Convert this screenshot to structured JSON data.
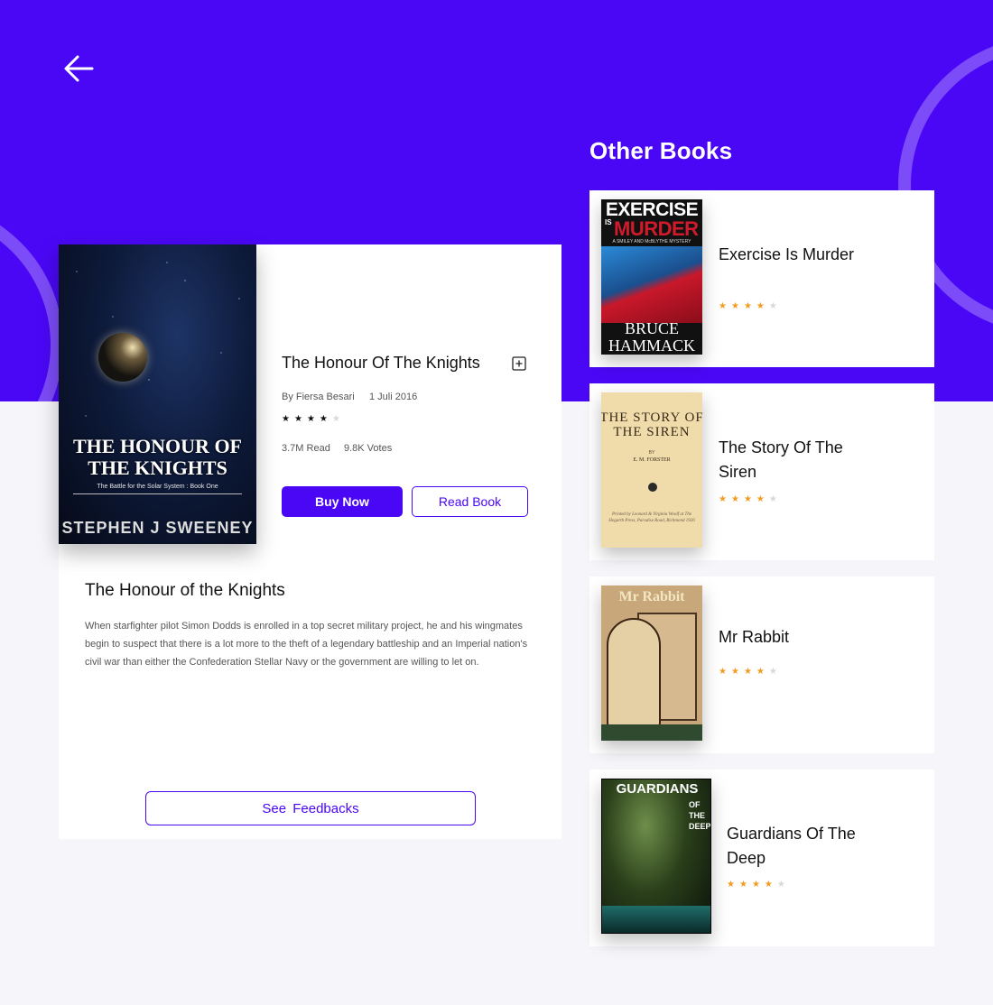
{
  "colors": {
    "accent": "#4a07f5",
    "star": "#f29c1f",
    "background": "#f6f6fa"
  },
  "header": {
    "back_icon": "arrow-left-icon"
  },
  "book": {
    "cover_title": "THE HONOUR OF THE KNIGHTS",
    "cover_subtitle": "The Battle for the Solar System : Book One",
    "cover_author": "STEPHEN J SWEENEY",
    "title": "The Honour Of The Knights",
    "author": "By Fiersa Besari",
    "date": "1 Juli 2016",
    "rating": 4,
    "rating_max": 5,
    "reads": "3.7M Read",
    "votes": "9.8K Votes",
    "buy_label": "Buy Now",
    "read_label": "Read Book",
    "bookmark_icon": "add-bookmark-icon",
    "description_title": "The Honour of the Knights",
    "description": "When starfighter pilot Simon Dodds is enrolled in a top secret military project, he and his wingmates begin to suspect that there is a lot more to the theft of a legendary battleship and an Imperial nation's civil war than either the Confederation Stellar Navy or the government are willing to let on.",
    "feedback_label": "See  Feedbacks"
  },
  "other_books": {
    "heading": "Other Books",
    "items": [
      {
        "title": "Exercise Is Murder",
        "rating": 4,
        "rating_max": 5,
        "cover": {
          "line1": "EXERCISE",
          "line2": "IS",
          "line3": "MURDER",
          "tag": "A SMILEY AND McBLYTHE MYSTERY",
          "author": "BRUCE HAMMACK"
        }
      },
      {
        "title": "The Story Of The Siren",
        "rating": 4,
        "rating_max": 5,
        "cover": {
          "line1": "THE STORY OF THE SIREN",
          "by": "BY",
          "author": "E. M. FORSTER",
          "imprint": "Printed by Leonard & Virginia Woolf at The Hogarth Press, Paradise Road, Richmond 1920"
        }
      },
      {
        "title": "Mr Rabbit",
        "rating": 4,
        "rating_max": 5,
        "cover": {
          "line1": "Mr Rabbit"
        }
      },
      {
        "title": "Guardians Of The Deep",
        "rating": 4,
        "rating_max": 5,
        "cover": {
          "line1": "GUARDIANS",
          "line2": "OF THE DEEP"
        }
      }
    ]
  }
}
